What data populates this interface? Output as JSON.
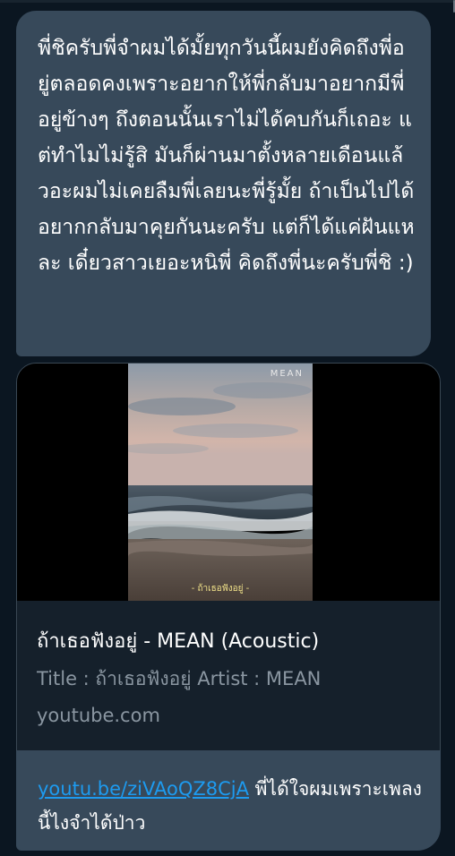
{
  "message": {
    "text": "พี่ชิครับพี่จำผมได้มั้ยทุกวันนี้ผมยังคิดถึงพี่อยู่ตลอดคงเพราะอยากให้พี่กลับมาอยากมีพี่อยู่ข้างๆ ถึงตอนนั้นเราไม่ได้คบกันก็เถอะ แต่ทำไมไม่รู้สิ มันก็ผ่านมาตั้งหลายเดือนแล้วอะผมไม่เคยลืมพี่เลยนะพี่รู้มั้ย ถ้าเป็นไปได้อยากกลับมาคุยกันนะครับ แต่ก็ได้แค่ฝันแหละ เดี๋ยวสาวเยอะหนิพี่ คิดถึงพี่นะครับพี่ชิ :)"
  },
  "link_card": {
    "thumbnail_watermark": "MEAN",
    "thumbnail_caption": "- ถ้าเธอฟังอยู่ -",
    "title": "ถ้าเธอฟังอยู่ - MEAN (Acoustic)",
    "description": "Title : ถ้าเธอฟังอยู่ Artist : MEAN",
    "domain": "youtube.com"
  },
  "reply": {
    "link_text": "youtu.be/ziVAoQZ8CjA",
    "text": " พี่ได้ใจผมเพราะเพลงนี้ไงจำได้ป่าว"
  },
  "colors": {
    "background": "#0b1621",
    "bubble": "#37495a",
    "link": "#1d9bf0",
    "muted": "#8a96a1"
  }
}
